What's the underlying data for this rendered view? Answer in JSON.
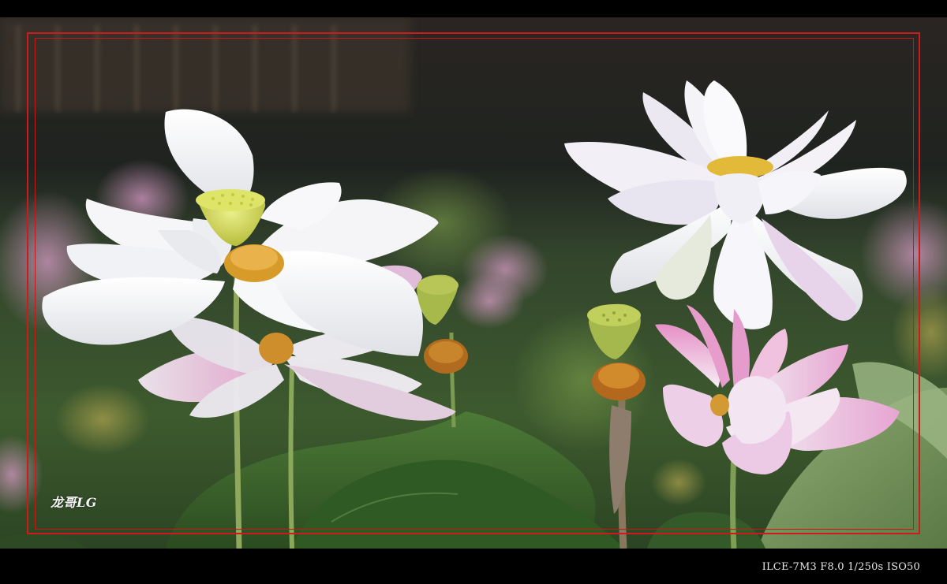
{
  "photo": {
    "subject": "lotus-flowers-and-seed-pods"
  },
  "watermark": {
    "signature": "龙哥LG"
  },
  "exif": {
    "text": "ILCE-7M3 F8.0 1/250s ISO50"
  },
  "colors": {
    "frame": "#d01a1a",
    "background": "#000000"
  }
}
